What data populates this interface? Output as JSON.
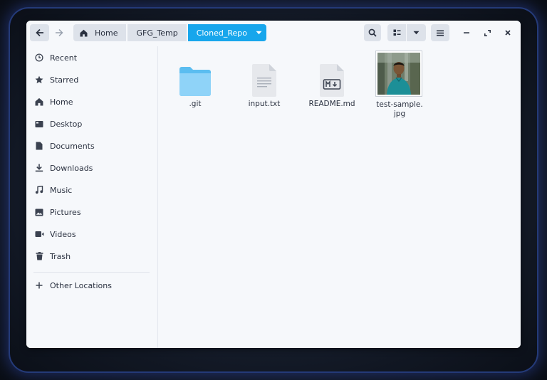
{
  "headerbar": {
    "breadcrumbs": [
      "Home",
      "GFG_Temp",
      "Cloned_Repo"
    ],
    "active_crumb": "Cloned_Repo",
    "accent_color": "#17a6ec"
  },
  "sidebar": {
    "items": [
      {
        "label": "Recent",
        "icon": "clock-icon"
      },
      {
        "label": "Starred",
        "icon": "star-icon"
      },
      {
        "label": "Home",
        "icon": "home-icon"
      },
      {
        "label": "Desktop",
        "icon": "desktop-icon"
      },
      {
        "label": "Documents",
        "icon": "document-icon"
      },
      {
        "label": "Downloads",
        "icon": "download-icon"
      },
      {
        "label": "Music",
        "icon": "music-icon"
      },
      {
        "label": "Pictures",
        "icon": "picture-icon"
      },
      {
        "label": "Videos",
        "icon": "video-icon"
      },
      {
        "label": "Trash",
        "icon": "trash-icon"
      }
    ],
    "other_locations": {
      "label": "Other Locations",
      "icon": "plus-icon"
    }
  },
  "files": [
    {
      "name": ".git",
      "type": "folder",
      "icon": "folder-icon"
    },
    {
      "name": "input.txt",
      "type": "text",
      "icon": "text-file-icon"
    },
    {
      "name": "README.md",
      "type": "markdown",
      "icon": "markdown-file-icon"
    },
    {
      "name_line1": "test-sample.",
      "name_line2": "jpg",
      "type": "image",
      "icon": "image-thumbnail"
    }
  ]
}
